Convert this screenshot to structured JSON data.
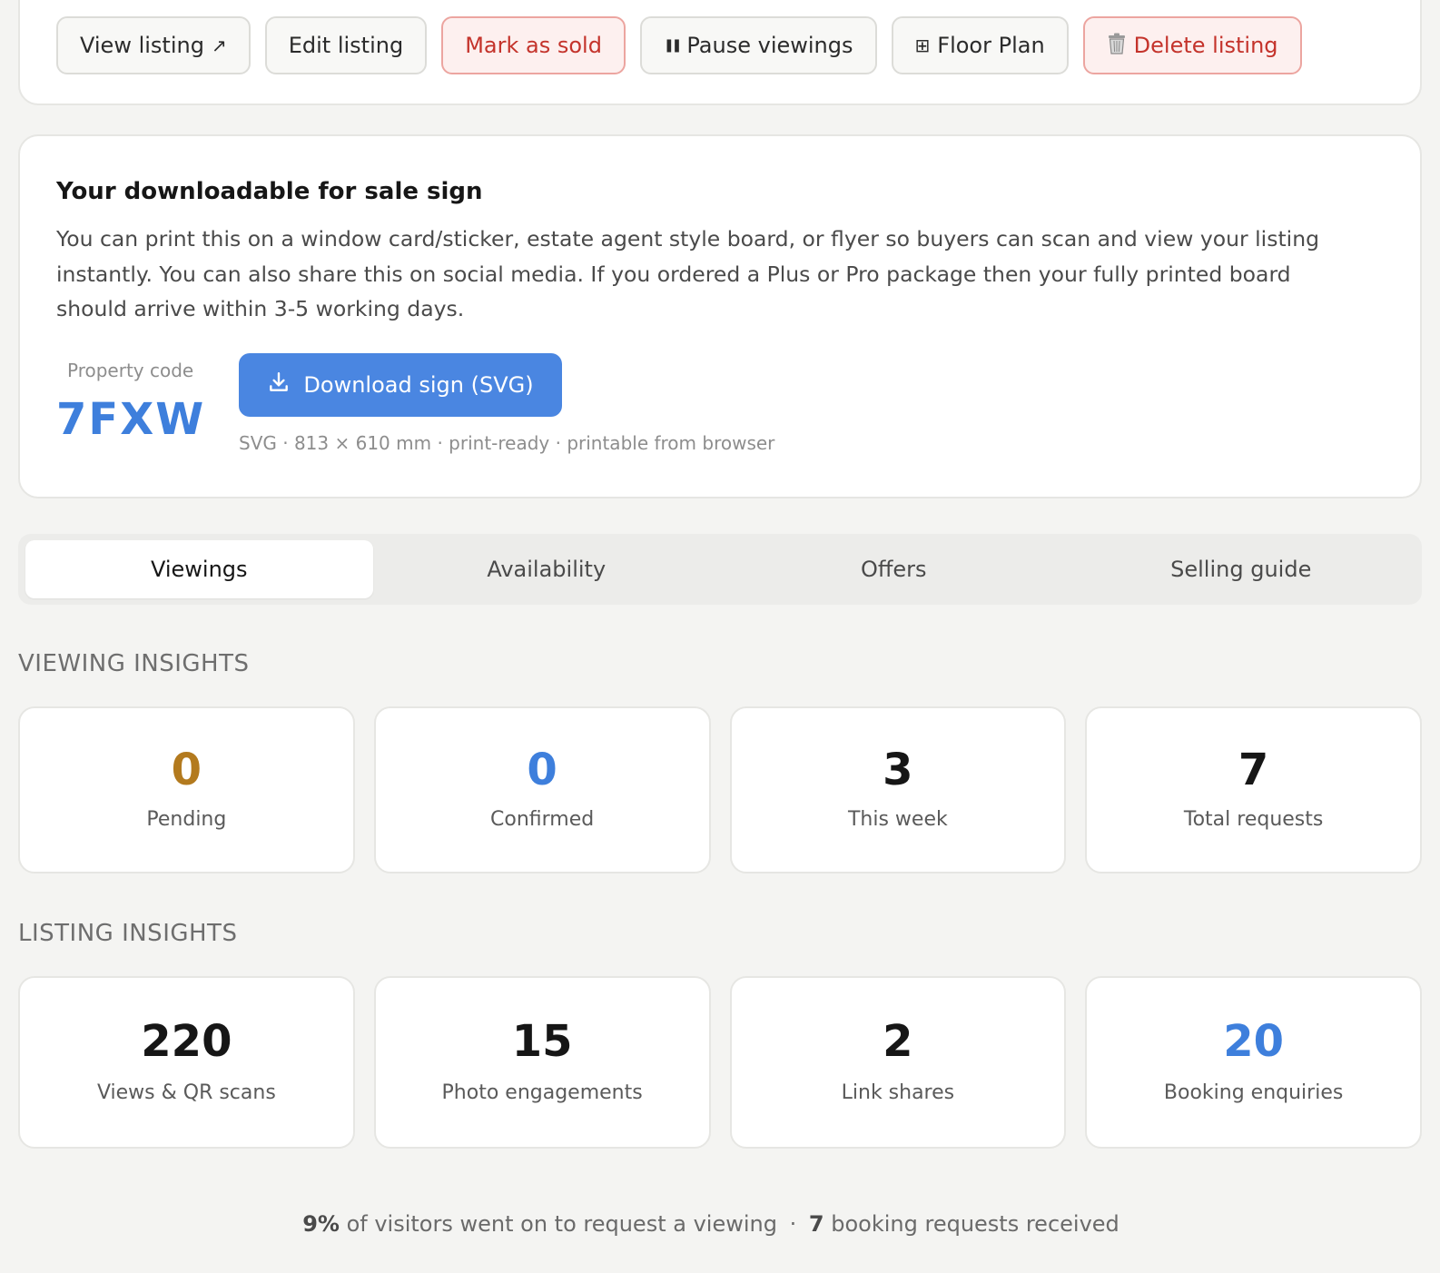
{
  "actions": [
    {
      "label": "View listing",
      "icon": "↗",
      "variant": "default"
    },
    {
      "label": "Edit listing",
      "icon": "",
      "variant": "default"
    },
    {
      "label": "Mark as sold",
      "icon": "",
      "variant": "danger"
    },
    {
      "label": "Pause viewings",
      "icon": "❚❚",
      "variant": "default"
    },
    {
      "label": "Floor Plan",
      "icon": "⊞",
      "variant": "default"
    },
    {
      "label": "Delete listing",
      "icon": "trash-icon",
      "variant": "danger"
    }
  ],
  "sign": {
    "title": "Your downloadable for sale sign",
    "description": "You can print this on a window card/sticker, estate agent style board, or flyer so buyers can scan and view your listing instantly. You can also share this on social media. If you ordered a Plus or Pro package then your fully printed board should arrive within 3-5 working days.",
    "code_label": "Property code",
    "code": "7FXW",
    "download_label": "Download sign (SVG)",
    "download_meta": "SVG · 813 × 610 mm · print-ready · printable from browser"
  },
  "tabs": [
    {
      "label": "Viewings",
      "active": true
    },
    {
      "label": "Availability",
      "active": false
    },
    {
      "label": "Offers",
      "active": false
    },
    {
      "label": "Selling guide",
      "active": false
    }
  ],
  "viewing_insights": {
    "title": "VIEWING INSIGHTS",
    "stats": [
      {
        "value": "0",
        "label": "Pending",
        "color": "#b37a1e"
      },
      {
        "value": "0",
        "label": "Confirmed",
        "color": "#3e7fdc"
      },
      {
        "value": "3",
        "label": "This week",
        "color": "#161616"
      },
      {
        "value": "7",
        "label": "Total requests",
        "color": "#161616"
      }
    ]
  },
  "listing_insights": {
    "title": "LISTING INSIGHTS",
    "stats": [
      {
        "value": "220",
        "label": "Views & QR scans",
        "color": "#161616"
      },
      {
        "value": "15",
        "label": "Photo engagements",
        "color": "#161616"
      },
      {
        "value": "2",
        "label": "Link shares",
        "color": "#161616"
      },
      {
        "value": "20",
        "label": "Booking enquiries",
        "color": "#3e7fdc"
      }
    ]
  },
  "footer": {
    "conversion": "9%",
    "conversion_text": "of visitors went on to request a viewing",
    "separator": "·",
    "bookings": "7",
    "bookings_text": "booking requests received"
  },
  "colors": {
    "accent": "#4a86e1",
    "danger": "#c4332b",
    "pending": "#b37a1e"
  }
}
